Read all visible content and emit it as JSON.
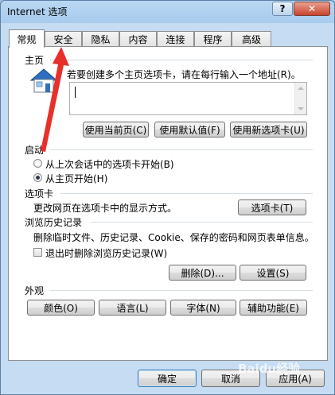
{
  "window": {
    "title": "Internet 选项",
    "help_label": "?",
    "close_label": "✕"
  },
  "tabs": [
    {
      "label": "常规",
      "active": true
    },
    {
      "label": "安全"
    },
    {
      "label": "隐私"
    },
    {
      "label": "内容"
    },
    {
      "label": "连接"
    },
    {
      "label": "程序"
    },
    {
      "label": "高级"
    }
  ],
  "homepage": {
    "section_label": "主页",
    "instruction": "若要创建多个主页选项卡，请在每行输入一个地址(R)。",
    "url_value": "",
    "buttons": {
      "use_current": "使用当前页(C)",
      "use_default": "使用默认值(F)",
      "use_new_tab": "使用新选项卡(U)"
    }
  },
  "startup": {
    "section_label": "启动",
    "option_last_session": "从上次会话中的选项卡开始(B)",
    "option_homepage": "从主页开始(H)"
  },
  "tabs_section": {
    "section_label": "选项卡",
    "description": "更改网页在选项卡中的显示方式。",
    "button": "选项卡(T)"
  },
  "history": {
    "section_label": "浏览历史记录",
    "description": "删除临时文件、历史记录、Cookie、保存的密码和网页表单信息。",
    "checkbox_label": "退出时删除浏览历史记录(W)",
    "delete_button": "删除(D)...",
    "settings_button": "设置(S)"
  },
  "appearance": {
    "section_label": "外观",
    "buttons": {
      "colors": "颜色(O)",
      "languages": "语言(L)",
      "fonts": "字体(N)",
      "accessibility": "辅助功能(E)"
    }
  },
  "footer": {
    "ok": "确定",
    "cancel": "取消",
    "apply": "应用(A)"
  },
  "watermark": "Baidu经验"
}
